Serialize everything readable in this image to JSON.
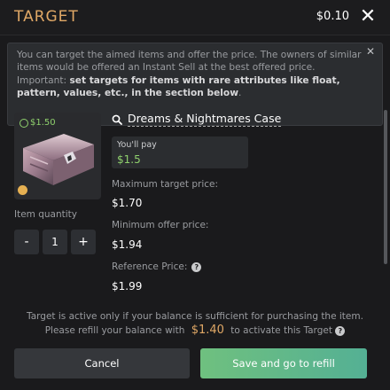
{
  "header": {
    "title": "TARGET",
    "balance": "$0.10",
    "close_icon": "close-icon"
  },
  "notice": {
    "text_plain": "You can target the aimed items and offer the price. The owners of similar items would be offered an Instant Sell at the best offered price. Important: ",
    "text_bold": "set targets for items with rare attributes like float, pattern, values, etc., in the section below",
    "text_end": "."
  },
  "item": {
    "price": "$1.50",
    "name": "Dreams & Nightmares Case"
  },
  "quantity": {
    "label": "Item quantity",
    "minus": "-",
    "value": "1",
    "plus": "+"
  },
  "pay": {
    "label": "You'll pay",
    "value": "$1.5"
  },
  "fields": {
    "max_label": "Maximum target price:",
    "max_value": "$1.70",
    "min_label": "Minimum offer price:",
    "min_value": "$1.94",
    "ref_label": "Reference Price:",
    "ref_value": "$1.99"
  },
  "footer": {
    "line1": "Target is active only if your balance is sufficient for purchasing the item.",
    "line2_before": "Please refill your balance with",
    "amount": "$1.40",
    "line2_after": "to activate this Target"
  },
  "buttons": {
    "cancel": "Cancel",
    "save": "Save and go to refill"
  },
  "colors": {
    "accent": "#e0a866",
    "green": "#8fd06d",
    "button_green": "#62b98a"
  }
}
